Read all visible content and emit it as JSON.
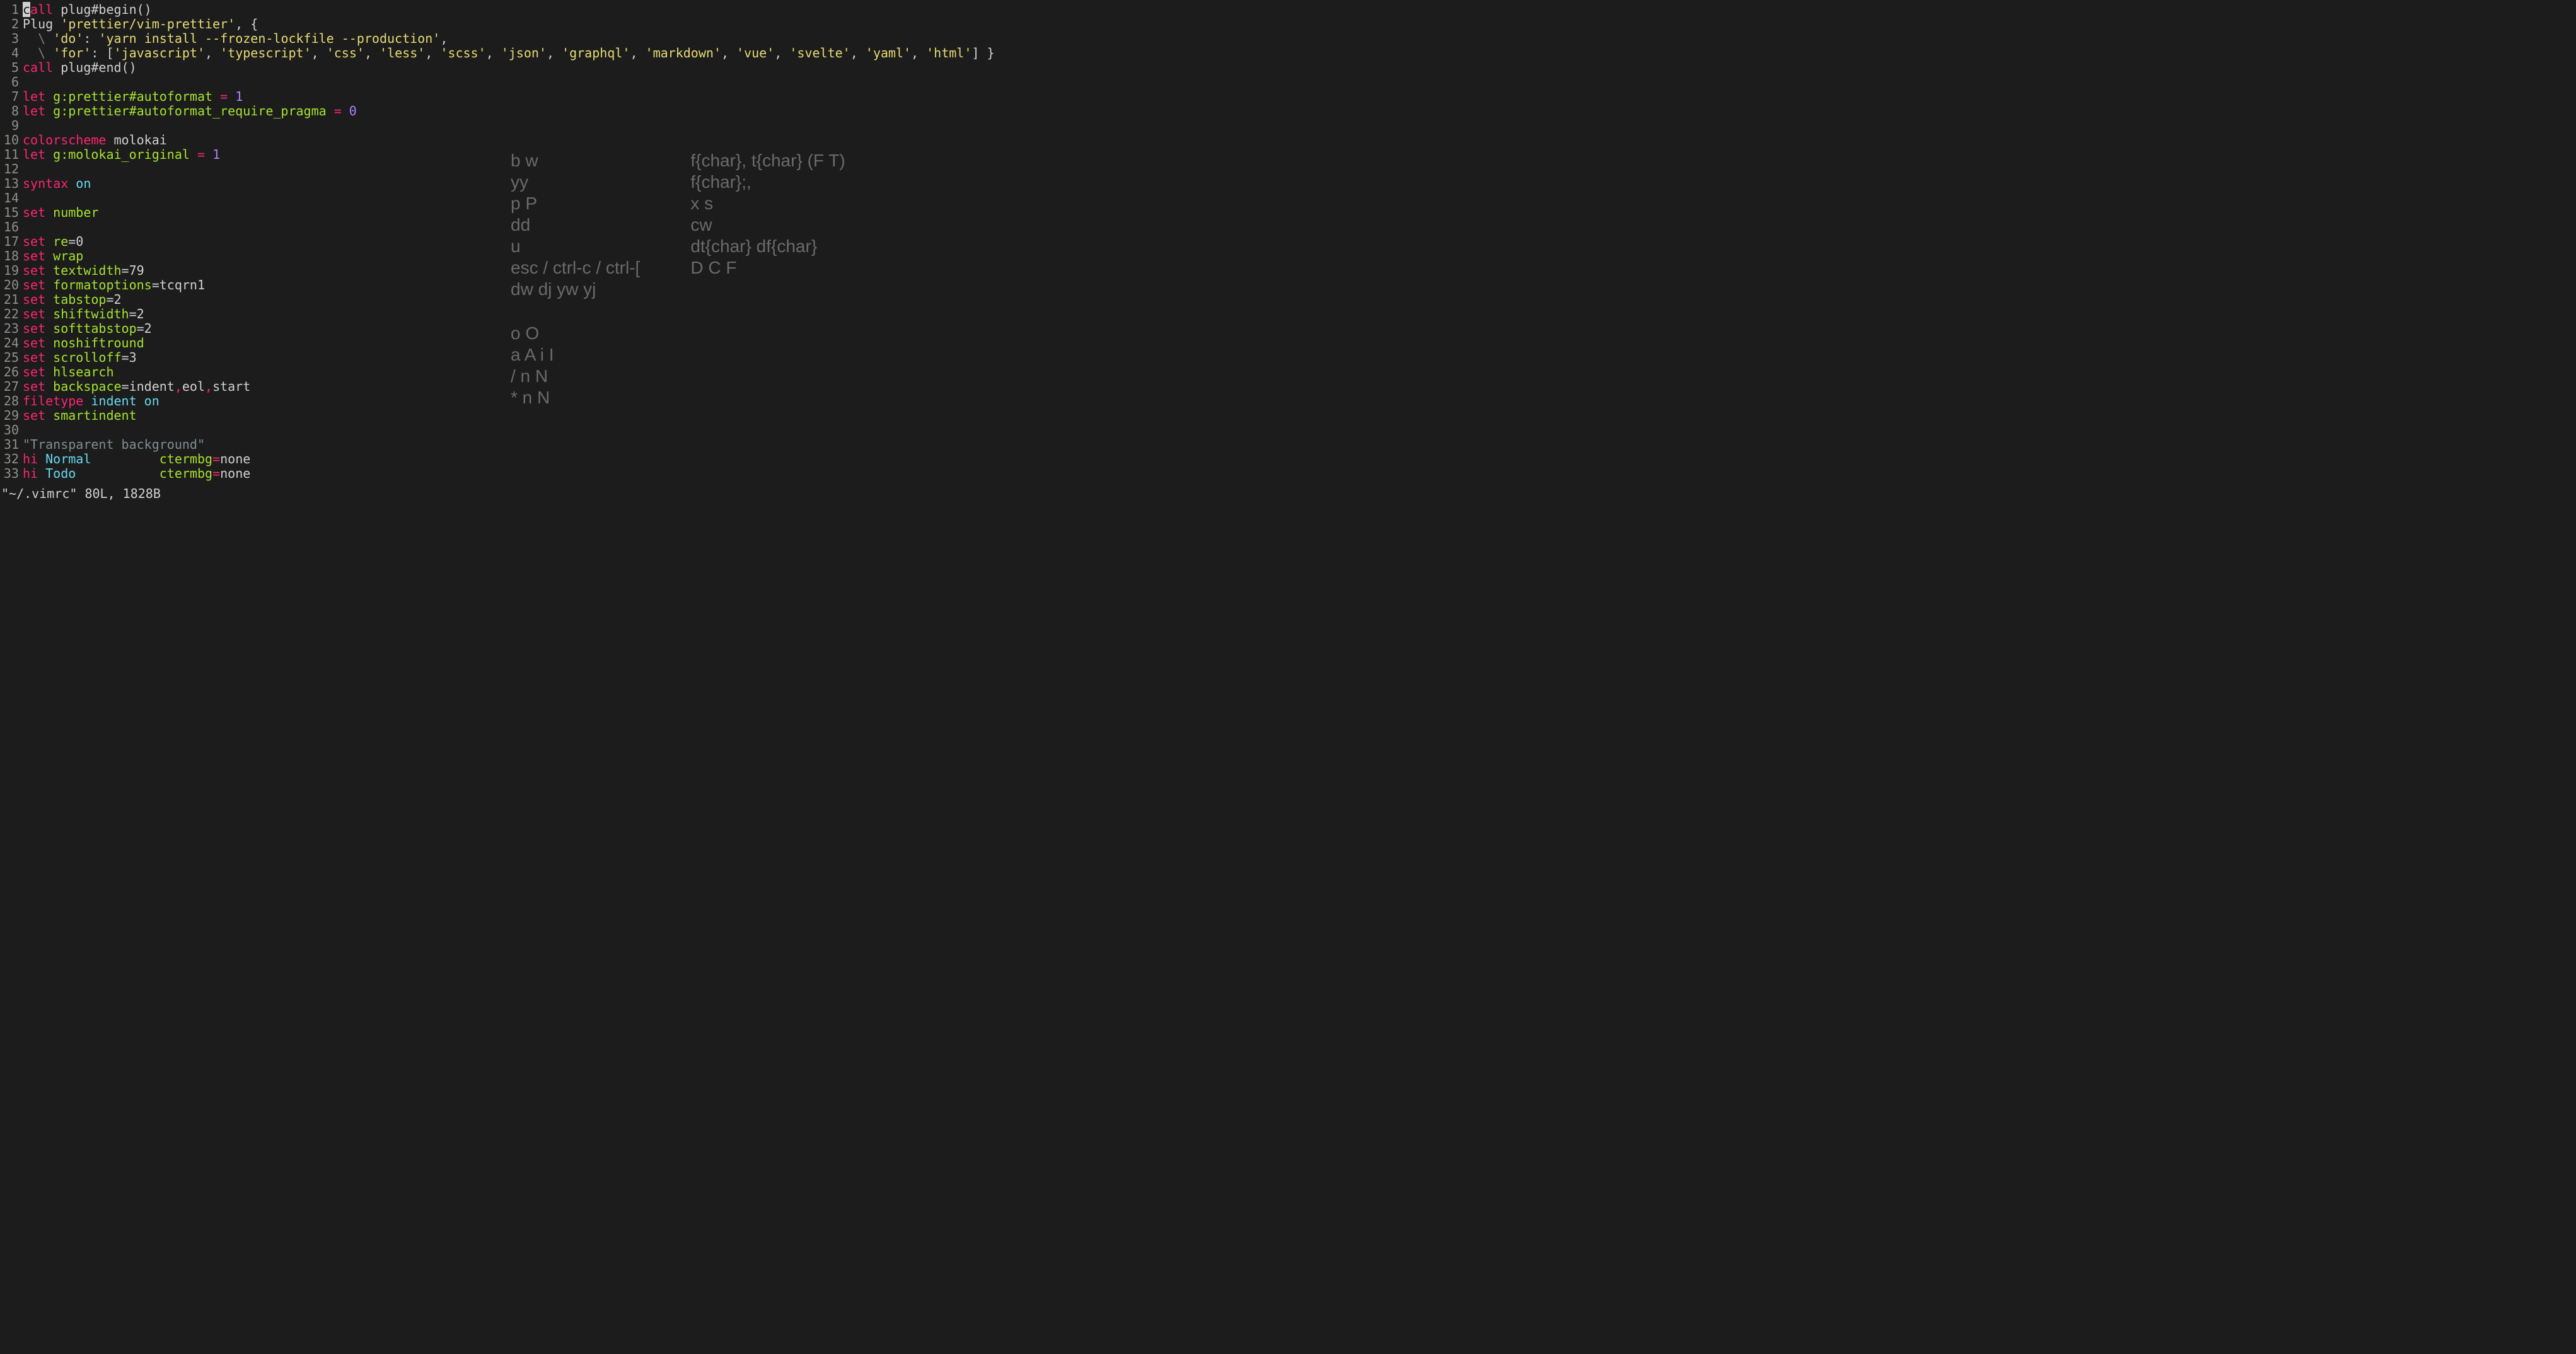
{
  "status_line": "\"~/.vimrc\" 80L, 1828B",
  "cursor_char": "c",
  "lines": [
    {
      "n": 1,
      "tokens": [
        {
          "t": "all",
          "cls": "kw-red"
        },
        {
          "t": " plug#begin",
          "cls": "plain"
        },
        {
          "t": "()",
          "cls": "paren"
        }
      ]
    },
    {
      "n": 2,
      "tokens": [
        {
          "t": "Plug ",
          "cls": "plain"
        },
        {
          "t": "'prettier/vim-prettier'",
          "cls": "str"
        },
        {
          "t": ", {",
          "cls": "plain"
        }
      ]
    },
    {
      "n": 3,
      "tokens": [
        {
          "t": "  ",
          "cls": "plain"
        },
        {
          "t": "\\",
          "cls": "gray"
        },
        {
          "t": " ",
          "cls": "plain"
        },
        {
          "t": "'do'",
          "cls": "str"
        },
        {
          "t": ": ",
          "cls": "plain"
        },
        {
          "t": "'yarn install --frozen-lockfile --production'",
          "cls": "str"
        },
        {
          "t": ",",
          "cls": "plain"
        }
      ]
    },
    {
      "n": 4,
      "tokens": [
        {
          "t": "  ",
          "cls": "plain"
        },
        {
          "t": "\\",
          "cls": "gray"
        },
        {
          "t": " ",
          "cls": "plain"
        },
        {
          "t": "'for'",
          "cls": "str"
        },
        {
          "t": ": [",
          "cls": "plain"
        },
        {
          "t": "'javascript'",
          "cls": "str"
        },
        {
          "t": ", ",
          "cls": "plain"
        },
        {
          "t": "'typescript'",
          "cls": "str"
        },
        {
          "t": ", ",
          "cls": "plain"
        },
        {
          "t": "'css'",
          "cls": "str"
        },
        {
          "t": ", ",
          "cls": "plain"
        },
        {
          "t": "'less'",
          "cls": "str"
        },
        {
          "t": ", ",
          "cls": "plain"
        },
        {
          "t": "'scss'",
          "cls": "str"
        },
        {
          "t": ", ",
          "cls": "plain"
        },
        {
          "t": "'json'",
          "cls": "str"
        },
        {
          "t": ", ",
          "cls": "plain"
        },
        {
          "t": "'graphql'",
          "cls": "str"
        },
        {
          "t": ", ",
          "cls": "plain"
        },
        {
          "t": "'markdown'",
          "cls": "str"
        },
        {
          "t": ", ",
          "cls": "plain"
        },
        {
          "t": "'vue'",
          "cls": "str"
        },
        {
          "t": ", ",
          "cls": "plain"
        },
        {
          "t": "'svelte'",
          "cls": "str"
        },
        {
          "t": ", ",
          "cls": "plain"
        },
        {
          "t": "'yaml'",
          "cls": "str"
        },
        {
          "t": ", ",
          "cls": "plain"
        },
        {
          "t": "'html'",
          "cls": "str"
        },
        {
          "t": "] }",
          "cls": "plain"
        }
      ]
    },
    {
      "n": 5,
      "tokens": [
        {
          "t": "call",
          "cls": "kw-red"
        },
        {
          "t": " plug#end",
          "cls": "plain"
        },
        {
          "t": "()",
          "cls": "paren"
        }
      ]
    },
    {
      "n": 6,
      "tokens": []
    },
    {
      "n": 7,
      "tokens": [
        {
          "t": "let",
          "cls": "kw-red"
        },
        {
          "t": " ",
          "cls": "plain"
        },
        {
          "t": "g:prettier#autoformat",
          "cls": "ident"
        },
        {
          "t": " ",
          "cls": "plain"
        },
        {
          "t": "=",
          "cls": "op"
        },
        {
          "t": " ",
          "cls": "plain"
        },
        {
          "t": "1",
          "cls": "num"
        }
      ]
    },
    {
      "n": 8,
      "tokens": [
        {
          "t": "let",
          "cls": "kw-red"
        },
        {
          "t": " ",
          "cls": "plain"
        },
        {
          "t": "g:prettier#autoformat_require_pragma",
          "cls": "ident"
        },
        {
          "t": " ",
          "cls": "plain"
        },
        {
          "t": "=",
          "cls": "op"
        },
        {
          "t": " ",
          "cls": "plain"
        },
        {
          "t": "0",
          "cls": "num"
        }
      ]
    },
    {
      "n": 9,
      "tokens": []
    },
    {
      "n": 10,
      "tokens": [
        {
          "t": "colorscheme",
          "cls": "kw-red"
        },
        {
          "t": " molokai",
          "cls": "plain"
        }
      ]
    },
    {
      "n": 11,
      "tokens": [
        {
          "t": "let",
          "cls": "kw-red"
        },
        {
          "t": " ",
          "cls": "plain"
        },
        {
          "t": "g:molokai_original",
          "cls": "ident"
        },
        {
          "t": " ",
          "cls": "plain"
        },
        {
          "t": "=",
          "cls": "op"
        },
        {
          "t": " ",
          "cls": "plain"
        },
        {
          "t": "1",
          "cls": "num"
        }
      ]
    },
    {
      "n": 12,
      "tokens": []
    },
    {
      "n": 13,
      "tokens": [
        {
          "t": "syntax",
          "cls": "kw-red"
        },
        {
          "t": " ",
          "cls": "plain"
        },
        {
          "t": "on",
          "cls": "cyan"
        }
      ]
    },
    {
      "n": 14,
      "tokens": []
    },
    {
      "n": 15,
      "tokens": [
        {
          "t": "set",
          "cls": "kw-red"
        },
        {
          "t": " ",
          "cls": "plain"
        },
        {
          "t": "number",
          "cls": "ident"
        }
      ]
    },
    {
      "n": 16,
      "tokens": []
    },
    {
      "n": 17,
      "tokens": [
        {
          "t": "set",
          "cls": "kw-red"
        },
        {
          "t": " ",
          "cls": "plain"
        },
        {
          "t": "re",
          "cls": "ident"
        },
        {
          "t": "=0",
          "cls": "plain"
        }
      ]
    },
    {
      "n": 18,
      "tokens": [
        {
          "t": "set",
          "cls": "kw-red"
        },
        {
          "t": " ",
          "cls": "plain"
        },
        {
          "t": "wrap",
          "cls": "ident"
        }
      ]
    },
    {
      "n": 19,
      "tokens": [
        {
          "t": "set",
          "cls": "kw-red"
        },
        {
          "t": " ",
          "cls": "plain"
        },
        {
          "t": "textwidth",
          "cls": "ident"
        },
        {
          "t": "=79",
          "cls": "plain"
        }
      ]
    },
    {
      "n": 20,
      "tokens": [
        {
          "t": "set",
          "cls": "kw-red"
        },
        {
          "t": " ",
          "cls": "plain"
        },
        {
          "t": "formatoptions",
          "cls": "ident"
        },
        {
          "t": "=tcqrn1",
          "cls": "plain"
        }
      ]
    },
    {
      "n": 21,
      "tokens": [
        {
          "t": "set",
          "cls": "kw-red"
        },
        {
          "t": " ",
          "cls": "plain"
        },
        {
          "t": "tabstop",
          "cls": "ident"
        },
        {
          "t": "=2",
          "cls": "plain"
        }
      ]
    },
    {
      "n": 22,
      "tokens": [
        {
          "t": "set",
          "cls": "kw-red"
        },
        {
          "t": " ",
          "cls": "plain"
        },
        {
          "t": "shiftwidth",
          "cls": "ident"
        },
        {
          "t": "=2",
          "cls": "plain"
        }
      ]
    },
    {
      "n": 23,
      "tokens": [
        {
          "t": "set",
          "cls": "kw-red"
        },
        {
          "t": " ",
          "cls": "plain"
        },
        {
          "t": "softtabstop",
          "cls": "ident"
        },
        {
          "t": "=2",
          "cls": "plain"
        }
      ]
    },
    {
      "n": 24,
      "tokens": [
        {
          "t": "set",
          "cls": "kw-red"
        },
        {
          "t": " ",
          "cls": "plain"
        },
        {
          "t": "noshiftround",
          "cls": "ident"
        }
      ]
    },
    {
      "n": 25,
      "tokens": [
        {
          "t": "set",
          "cls": "kw-red"
        },
        {
          "t": " ",
          "cls": "plain"
        },
        {
          "t": "scrolloff",
          "cls": "ident"
        },
        {
          "t": "=3",
          "cls": "plain"
        }
      ]
    },
    {
      "n": 26,
      "tokens": [
        {
          "t": "set",
          "cls": "kw-red"
        },
        {
          "t": " ",
          "cls": "plain"
        },
        {
          "t": "hlsearch",
          "cls": "ident"
        }
      ]
    },
    {
      "n": 27,
      "tokens": [
        {
          "t": "set",
          "cls": "kw-red"
        },
        {
          "t": " ",
          "cls": "plain"
        },
        {
          "t": "backspace",
          "cls": "ident"
        },
        {
          "t": "=indent",
          "cls": "plain"
        },
        {
          "t": ",",
          "cls": "op"
        },
        {
          "t": "eol",
          "cls": "plain"
        },
        {
          "t": ",",
          "cls": "op"
        },
        {
          "t": "start",
          "cls": "plain"
        }
      ]
    },
    {
      "n": 28,
      "tokens": [
        {
          "t": "filetype",
          "cls": "kw-red"
        },
        {
          "t": " ",
          "cls": "plain"
        },
        {
          "t": "indent",
          "cls": "cyan"
        },
        {
          "t": " ",
          "cls": "plain"
        },
        {
          "t": "on",
          "cls": "cyan"
        }
      ]
    },
    {
      "n": 29,
      "tokens": [
        {
          "t": "set",
          "cls": "kw-red"
        },
        {
          "t": " ",
          "cls": "plain"
        },
        {
          "t": "smartindent",
          "cls": "ident"
        }
      ]
    },
    {
      "n": 30,
      "tokens": []
    },
    {
      "n": 31,
      "tokens": [
        {
          "t": "\"Transparent background\"",
          "cls": "comment"
        }
      ]
    },
    {
      "n": 32,
      "tokens": [
        {
          "t": "hi",
          "cls": "kw-red"
        },
        {
          "t": " ",
          "cls": "plain"
        },
        {
          "t": "Normal",
          "cls": "cyan"
        },
        {
          "t": "         ",
          "cls": "plain"
        },
        {
          "t": "ctermbg",
          "cls": "ident"
        },
        {
          "t": "=",
          "cls": "op"
        },
        {
          "t": "none",
          "cls": "plain"
        }
      ]
    },
    {
      "n": 33,
      "tokens": [
        {
          "t": "hi",
          "cls": "kw-red"
        },
        {
          "t": " ",
          "cls": "plain"
        },
        {
          "t": "Todo",
          "cls": "cyan"
        },
        {
          "t": "           ",
          "cls": "plain"
        },
        {
          "t": "ctermbg",
          "cls": "ident"
        },
        {
          "t": "=",
          "cls": "op"
        },
        {
          "t": "none",
          "cls": "plain"
        }
      ]
    }
  ],
  "cheatsheet": {
    "col1": [
      [
        "b w",
        "yy",
        "p P",
        "dd",
        "u",
        "esc / ctrl-c / ctrl-[",
        "dw dj yw yj"
      ],
      [
        "o O",
        "a A i I",
        "/ n N",
        "* n N"
      ]
    ],
    "col2": [
      [
        "f{char}, t{char} (F T)",
        "f{char};,",
        "x s",
        "cw",
        "dt{char} df{char}",
        "D C F"
      ]
    ]
  }
}
